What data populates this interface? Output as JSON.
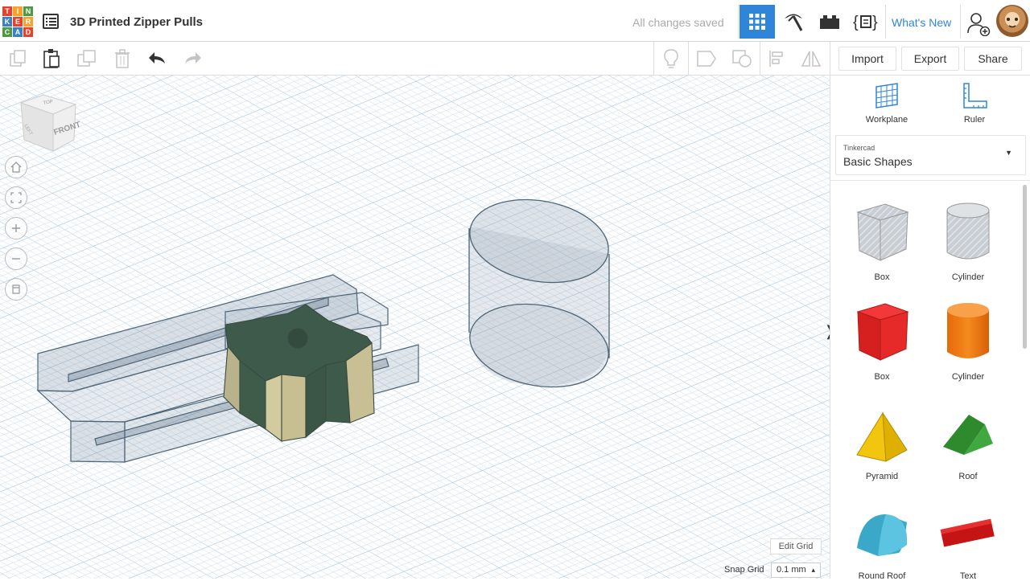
{
  "app": {
    "logo_letters": [
      "T",
      "I",
      "N",
      "K",
      "E",
      "R",
      "C",
      "A",
      "D"
    ],
    "logo_colors": [
      "#e8402a",
      "#f7a22b",
      "#4e9a44",
      "#3b7fc4",
      "#e8402a",
      "#f7a22b",
      "#4e9a44",
      "#3b7fc4",
      "#e8402a"
    ],
    "project_title": "3D Printed Zipper Pulls",
    "save_status": "All changes saved",
    "whats_new": "What's New",
    "accent": "#2f86d9"
  },
  "header": {
    "view_buttons": [
      "3d-design-grid-icon",
      "blocks-pickaxe-icon",
      "bricks-icon",
      "codeblocks-icon"
    ],
    "user_icons": [
      "add-user-icon",
      "avatar"
    ]
  },
  "toolbar": {
    "left_icons": [
      "copy-icon",
      "paste-icon",
      "duplicate-icon",
      "delete-icon",
      "undo-icon",
      "redo-icon"
    ],
    "right_icons": [
      "light-bulb-icon",
      "comment-icon",
      "shape-group-icon",
      "align-icon",
      "mirror-icon"
    ],
    "import_label": "Import",
    "export_label": "Export",
    "share_label": "Share"
  },
  "viewcube": {
    "top": "TOP",
    "front": "FRONT",
    "left": "LEFT"
  },
  "workplane": {
    "edit_grid_label": "Edit Grid",
    "snap_grid_label": "Snap Grid",
    "snap_grid_value": "0.1 mm"
  },
  "sidebar": {
    "workplane_label": "Workplane",
    "ruler_label": "Ruler",
    "library_source": "Tinkercad",
    "library_name": "Basic Shapes",
    "shapes": [
      {
        "label": "Box",
        "icon": "box-hole-icon"
      },
      {
        "label": "Cylinder",
        "icon": "cylinder-hole-icon"
      },
      {
        "label": "Box",
        "icon": "box-red-icon"
      },
      {
        "label": "Cylinder",
        "icon": "cylinder-orange-icon"
      },
      {
        "label": "Pyramid",
        "icon": "pyramid-yellow-icon"
      },
      {
        "label": "Roof",
        "icon": "roof-green-icon"
      },
      {
        "label": "Round Roof",
        "icon": "round-roof-teal-icon"
      },
      {
        "label": "Text",
        "icon": "text-red-icon"
      }
    ]
  }
}
